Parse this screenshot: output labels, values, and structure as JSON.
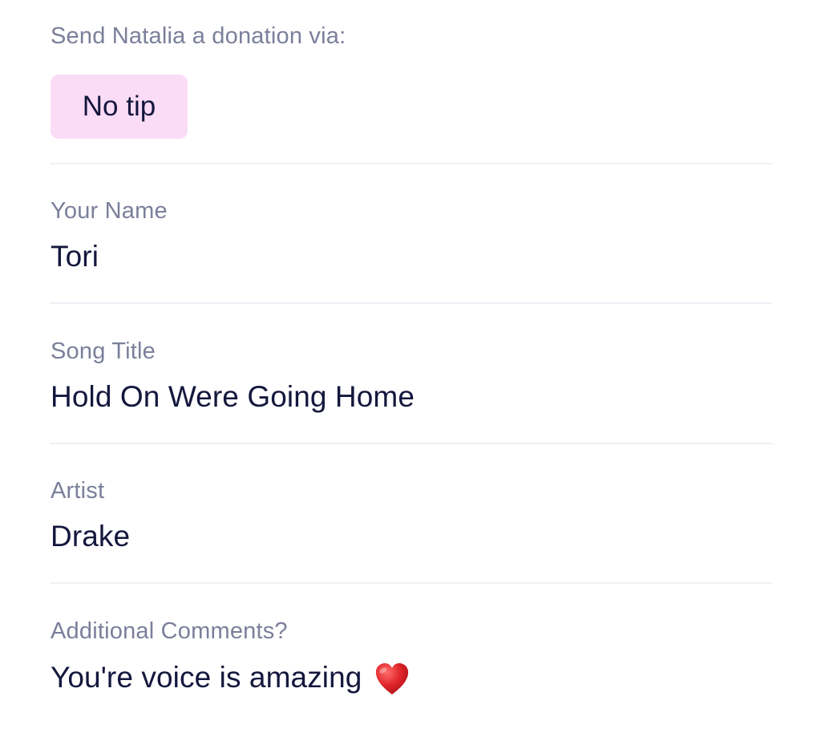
{
  "donation": {
    "label": "Send Natalia a donation via:",
    "selected_tip": "No tip"
  },
  "fields": {
    "name": {
      "label": "Your Name",
      "value": "Tori"
    },
    "song_title": {
      "label": "Song Title",
      "value": "Hold On Were Going Home"
    },
    "artist": {
      "label": "Artist",
      "value": "Drake"
    },
    "comments": {
      "label": "Additional Comments?",
      "value": "You're voice is amazing",
      "emoji": "heart-icon"
    }
  },
  "colors": {
    "label_text": "#7b7f9a",
    "value_text": "#14173d",
    "chip_background": "#fbdcf6",
    "divider": "#eef0f5",
    "heart": "#e0252a"
  }
}
